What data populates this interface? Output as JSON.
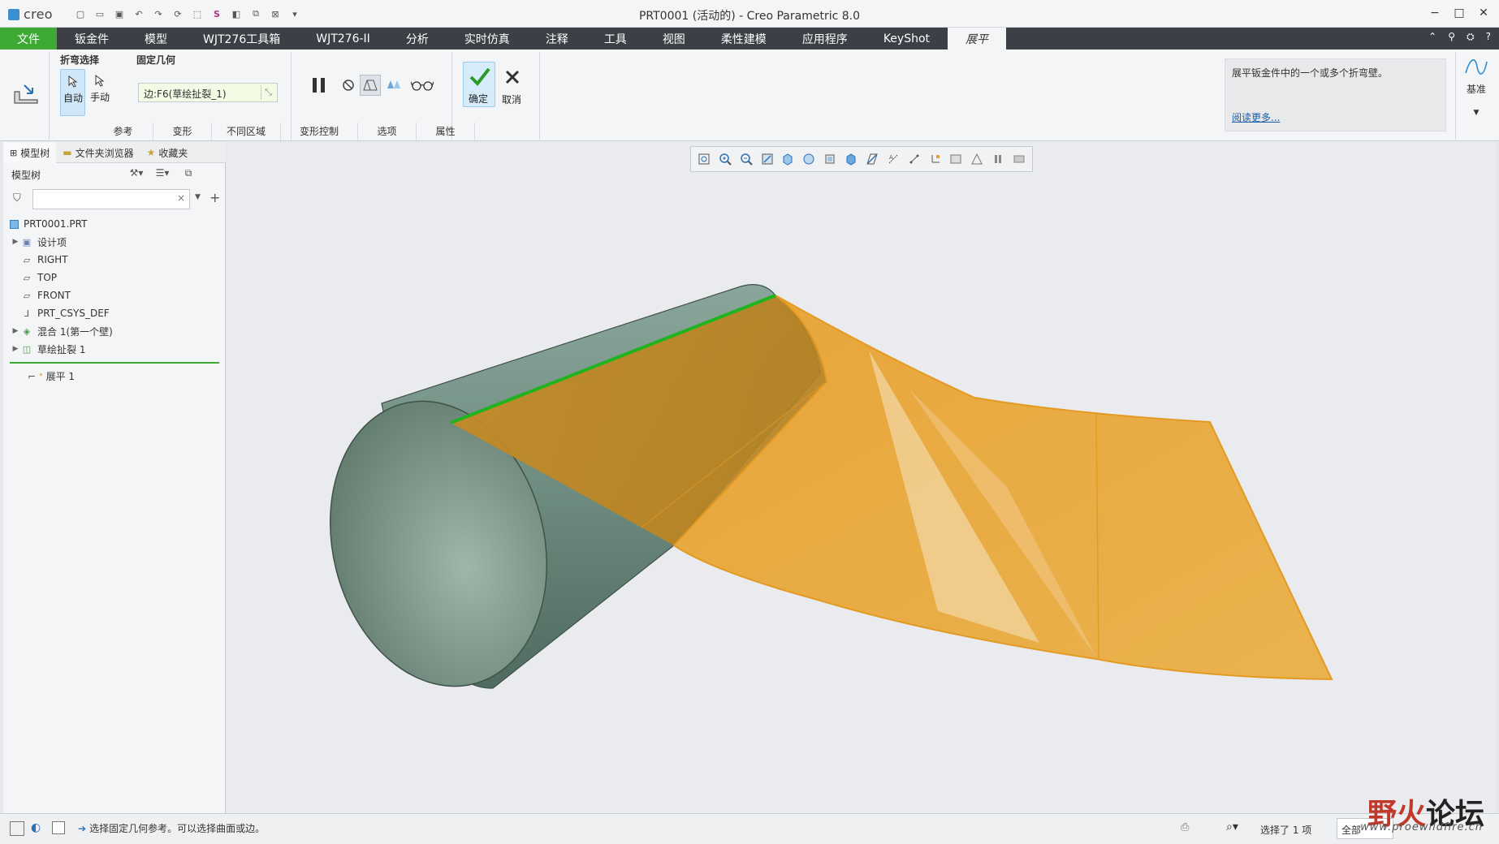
{
  "app": {
    "logo": "creo",
    "window_title": "PRT0001 (活动的) - Creo Parametric 8.0",
    "accent": "#3ea935"
  },
  "ribbon": {
    "tabs": [
      "文件",
      "钣金件",
      "模型",
      "WJT276工具箱",
      "WJT276-II",
      "分析",
      "实时仿真",
      "注释",
      "工具",
      "视图",
      "柔性建模",
      "应用程序",
      "KeyShot",
      "展平"
    ],
    "active_tab": "展平",
    "bend_select": {
      "title": "折弯选择",
      "auto_label": "自动",
      "manual_label": "手动"
    },
    "fixed_geom": {
      "title": "固定几何",
      "value": "边:F6(草绘扯裂_1)"
    },
    "ok_label": "确定",
    "cancel_label": "取消",
    "help_text": "展平钣金件中的一个或多个折弯壁。",
    "help_link": "阅读更多...",
    "datum_label": "基准",
    "sub_tabs": [
      "参考",
      "变形",
      "不同区域",
      "变形控制",
      "选项",
      "属性"
    ]
  },
  "navigator": {
    "tabs": [
      "模型树",
      "文件夹浏览器",
      "收藏夹"
    ],
    "tree_header": "模型树",
    "filter_placeholder": "",
    "items": [
      {
        "label": "PRT0001.PRT",
        "icon": "part-icon",
        "expandable": false
      },
      {
        "label": "设计项",
        "icon": "design-items-icon",
        "expandable": true
      },
      {
        "label": "RIGHT",
        "icon": "datum-plane-icon",
        "expandable": false
      },
      {
        "label": "TOP",
        "icon": "datum-plane-icon",
        "expandable": false
      },
      {
        "label": "FRONT",
        "icon": "datum-plane-icon",
        "expandable": false
      },
      {
        "label": "PRT_CSYS_DEF",
        "icon": "csys-icon",
        "expandable": false
      },
      {
        "label": "混合 1(第一个壁)",
        "icon": "blend-icon",
        "expandable": true
      },
      {
        "label": "草绘扯裂 1",
        "icon": "sketch-rip-icon",
        "expandable": true
      }
    ],
    "new_feature": "展平 1"
  },
  "status": {
    "message": "选择固定几何参考。可以选择曲面或边。",
    "selection": "选择了 1 项",
    "filter": "全部"
  },
  "watermark": {
    "text1": "野火",
    "text2": "论坛",
    "url": "www.proewildfire.cn"
  }
}
